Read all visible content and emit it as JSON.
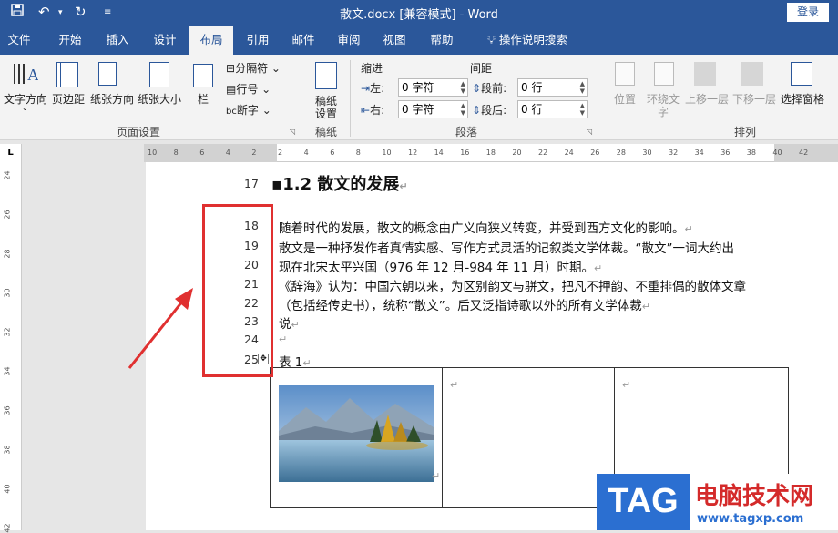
{
  "window": {
    "title": "散文.docx [兼容模式] - Word",
    "login_label": "登录"
  },
  "tabs": [
    "文件",
    "开始",
    "插入",
    "设计",
    "布局",
    "引用",
    "邮件",
    "审阅",
    "视图",
    "帮助",
    "操作说明搜索"
  ],
  "active_tab": "布局",
  "ribbon": {
    "page_setup": {
      "text_direction": "文字方向",
      "margins": "页边距",
      "orientation": "纸张方向",
      "size": "纸张大小",
      "columns": "栏",
      "breaks": "分隔符",
      "line_numbers": "行号",
      "hyphenation": "断字",
      "label": "页面设置"
    },
    "manuscript": {
      "button": "稿纸\n设置",
      "button_line1": "稿纸",
      "button_line2": "设置",
      "label": "稿纸"
    },
    "paragraph": {
      "indent": "缩进",
      "left_label": "左:",
      "left_value": "0 字符",
      "right_label": "右:",
      "right_value": "0 字符",
      "spacing": "间距",
      "before_label": "段前:",
      "before_value": "0 行",
      "after_label": "段后:",
      "after_value": "0 行",
      "label": "段落"
    },
    "arrange": {
      "position": "位置",
      "wrap_line1": "环绕文",
      "wrap_line2": "字",
      "forward": "上移一层",
      "backward": "下移一层",
      "selection_pane": "选择窗格",
      "label": "排列"
    }
  },
  "ruler": {
    "h_ticks": [
      "10",
      "8",
      "6",
      "4",
      "2",
      "2",
      "4",
      "6",
      "8",
      "10",
      "12",
      "14",
      "16",
      "18",
      "20",
      "22",
      "24",
      "26",
      "28",
      "30",
      "32",
      "34",
      "36",
      "38",
      "40",
      "42"
    ],
    "v_ticks": [
      "24",
      "26",
      "28",
      "30",
      "32",
      "34",
      "36",
      "38",
      "40",
      "42"
    ]
  },
  "document": {
    "heading_line": "17",
    "heading": "1.2 散文的发展",
    "lines": [
      {
        "num": "18",
        "text": "随着时代的发展，散文的概念由广义向狭义转变，并受到西方文化的影响。"
      },
      {
        "num": "19",
        "text": "散文是一种抒发作者真情实感、写作方式灵活的记叙类文学体裁。“散文”一词大约出"
      },
      {
        "num": "20",
        "text": "现在北宋太平兴国（976 年 12 月-984 年 11 月）时期。"
      },
      {
        "num": "21",
        "text": "《辞海》认为：中国六朝以来，为区别韵文与骈文，把凡不押韵、不重排偶的散体文章"
      },
      {
        "num": "22",
        "text": "（包括经传史书），统称“散文”。后又泛指诗歌以外的所有文学体裁"
      },
      {
        "num": "23",
        "text": "说"
      },
      {
        "num": "24",
        "text": ""
      },
      {
        "num": "25",
        "text": "表  1"
      }
    ]
  },
  "watermark": {
    "tag": "TAG",
    "site_name": "电脑技术网",
    "url": "www.tagxp.com"
  }
}
